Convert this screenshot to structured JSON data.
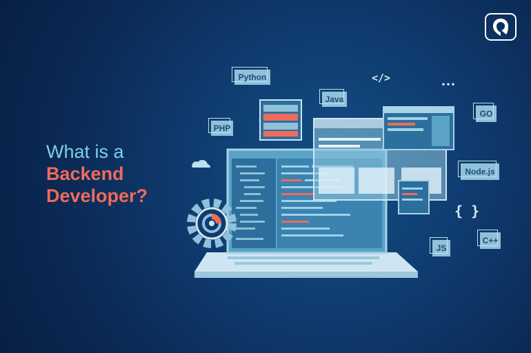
{
  "headline": {
    "line1": "What is a",
    "line2": "Backend",
    "line3": "Developer?"
  },
  "tags": {
    "python": "Python",
    "java": "Java",
    "php": "PHP",
    "go": "GO",
    "nodejs": "Node.js",
    "js": "JS",
    "cpp": "C++"
  },
  "symbols": {
    "code": "</>",
    "dots": "•••",
    "braces": "{ }"
  },
  "colors": {
    "background": "#0b2a55",
    "accent_blue": "#7fd0e6",
    "accent_red": "#f06b5b",
    "tag_fill": "#8fc1db"
  }
}
